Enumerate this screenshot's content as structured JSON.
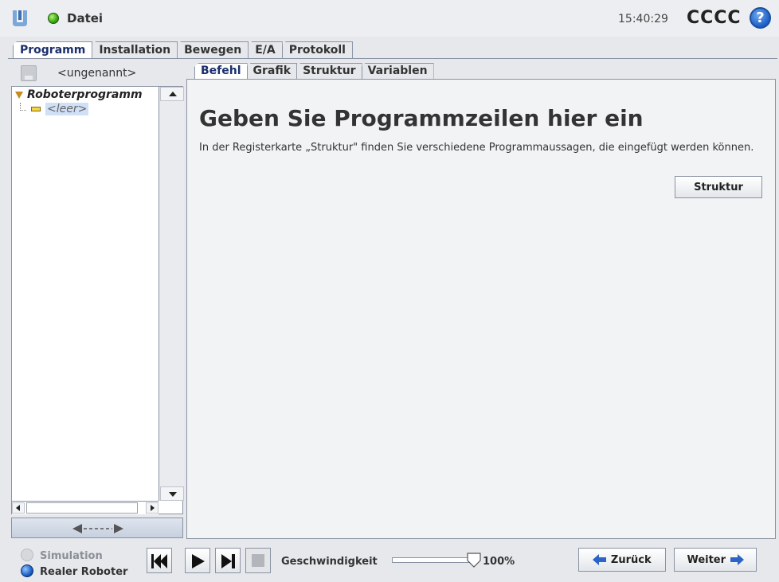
{
  "header": {
    "file_menu": "Datei",
    "time": "15:40:29",
    "robot_name": "CCCC",
    "help": "?"
  },
  "main_tabs": [
    "Programm",
    "Installation",
    "Bewegen",
    "E/A",
    "Protokoll"
  ],
  "main_tab_active": "Programm",
  "left_panel": {
    "program_name": "<ungenannt>",
    "tree": {
      "root": "Roboterprogramm",
      "child": "<leer>"
    }
  },
  "sub_tabs": [
    "Befehl",
    "Grafik",
    "Struktur",
    "Variablen"
  ],
  "sub_tab_active": "Befehl",
  "content": {
    "title": "Geben Sie Programmzeilen hier ein",
    "description": "In der Registerkarte „Struktur\" finden Sie verschiedene Programmaussagen, die eingefügt werden können.",
    "structure_button": "Struktur"
  },
  "footer": {
    "simulation_label": "Simulation",
    "real_robot_label": "Realer Roboter",
    "speed_label": "Geschwindigkeit",
    "speed_value": "100%",
    "speed_fraction": 1.0,
    "back_button": "Zurück",
    "next_button": "Weiter"
  },
  "colors": {
    "status_green": "#3fae16",
    "accent_blue": "#1d5fc7",
    "active_tab_text": "#1b2f6b",
    "tree_folder": "#c78a1c"
  },
  "icons": {
    "logo": "ur-logo-icon",
    "status": "status-ok-icon",
    "help": "help-icon",
    "save": "save-icon",
    "skip_back": "skip-back-icon",
    "play": "play-icon",
    "step": "step-forward-icon",
    "stop": "stop-icon",
    "back_arrow": "arrow-left-icon",
    "next_arrow": "arrow-right-icon"
  }
}
